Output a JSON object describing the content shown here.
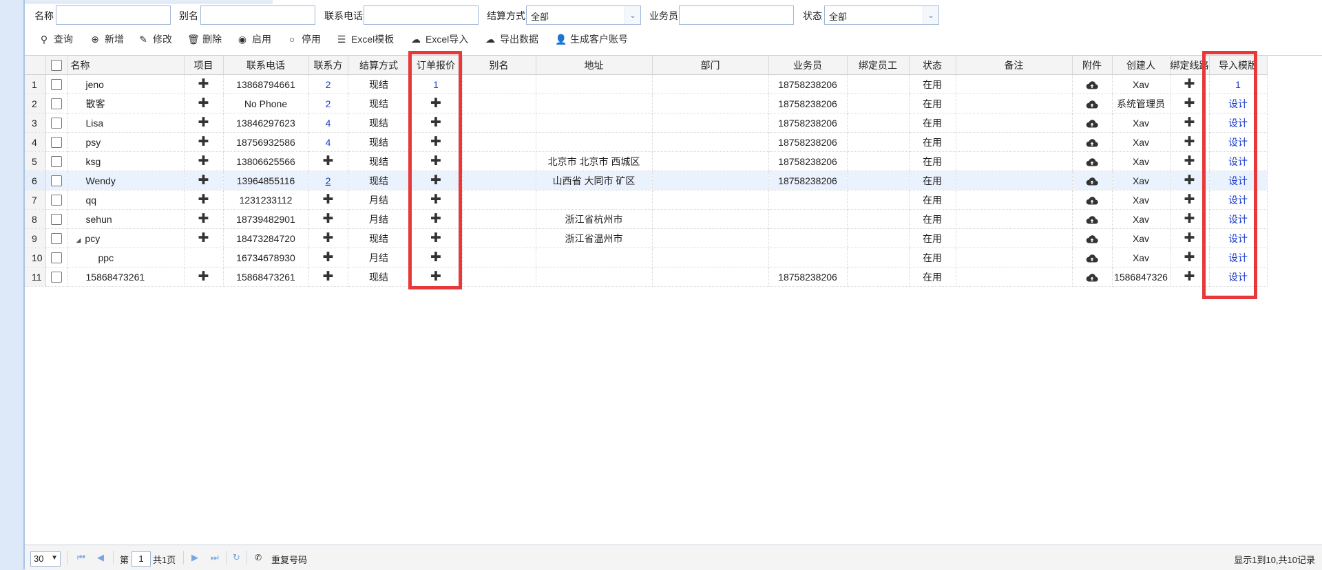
{
  "filters": {
    "name_label": "名称",
    "alias_label": "别名",
    "phone_label": "联系电话",
    "settlement_label": "结算方式",
    "settlement_value": "全部",
    "salesman_label": "业务员",
    "status_label": "状态",
    "status_value": "全部"
  },
  "toolbar": {
    "query": "查询",
    "add": "新增",
    "edit": "修改",
    "delete": "删除",
    "enable": "启用",
    "disable": "停用",
    "excel_template": "Excel模板",
    "excel_import": "Excel导入",
    "export": "导出数据",
    "gen_account": "生成客户账号"
  },
  "columns": [
    "名称",
    "项目",
    "联系电话",
    "联系方",
    "结算方式",
    "订单报价",
    "别名",
    "地址",
    "部门",
    "业务员",
    "绑定员工",
    "状态",
    "备注",
    "附件",
    "创建人",
    "绑定线路",
    "导入模版"
  ],
  "rows": [
    {
      "n": "1",
      "name": "jeno",
      "phone": "13868794661",
      "contacts": "2",
      "settle": "现结",
      "quote": "1",
      "addr": "",
      "salesman": "18758238206",
      "status": "在用",
      "creator": "Xav",
      "tpl": "1"
    },
    {
      "n": "2",
      "name": "散客",
      "phone": "No Phone",
      "contacts": "2",
      "settle": "现结",
      "quote": "",
      "addr": "",
      "salesman": "18758238206",
      "status": "在用",
      "creator": "系统管理员",
      "tpl": "设计"
    },
    {
      "n": "3",
      "name": "Lisa",
      "phone": "13846297623",
      "contacts": "4",
      "settle": "现结",
      "quote": "",
      "addr": "",
      "salesman": "18758238206",
      "status": "在用",
      "creator": "Xav",
      "tpl": "设计"
    },
    {
      "n": "4",
      "name": "psy",
      "phone": "18756932586",
      "contacts": "4",
      "settle": "现结",
      "quote": "",
      "addr": "",
      "salesman": "18758238206",
      "status": "在用",
      "creator": "Xav",
      "tpl": "设计"
    },
    {
      "n": "5",
      "name": "ksg",
      "phone": "13806625566",
      "contacts": "",
      "settle": "现结",
      "quote": "",
      "addr": "北京市 北京市 西城区",
      "salesman": "18758238206",
      "status": "在用",
      "creator": "Xav",
      "tpl": "设计"
    },
    {
      "n": "6",
      "name": "Wendy",
      "phone": "13964855116",
      "contacts": "2",
      "settle": "现结",
      "quote": "",
      "addr": "山西省 大同市 矿区",
      "salesman": "18758238206",
      "status": "在用",
      "creator": "Xav",
      "tpl": "设计"
    },
    {
      "n": "7",
      "name": "qq",
      "phone": "1231233112",
      "contacts": "",
      "settle": "月结",
      "quote": "",
      "addr": "",
      "salesman": "",
      "status": "在用",
      "creator": "Xav",
      "tpl": "设计"
    },
    {
      "n": "8",
      "name": "sehun",
      "phone": "18739482901",
      "contacts": "",
      "settle": "月结",
      "quote": "",
      "addr": "浙江省杭州市",
      "salesman": "",
      "status": "在用",
      "creator": "Xav",
      "tpl": "设计"
    },
    {
      "n": "9",
      "name": "pcy",
      "phone": "18473284720",
      "contacts": "",
      "settle": "现结",
      "quote": "",
      "addr": "浙江省温州市",
      "salesman": "",
      "status": "在用",
      "creator": "Xav",
      "tpl": "设计"
    },
    {
      "n": "10",
      "name": "ppc",
      "phone": "16734678930",
      "contacts": "",
      "settle": "月结",
      "quote": "",
      "addr": "",
      "salesman": "",
      "status": "在用",
      "creator": "Xav",
      "tpl": "设计"
    },
    {
      "n": "11",
      "name": "15868473261",
      "phone": "15868473261",
      "contacts": "",
      "settle": "现结",
      "quote": "",
      "addr": "",
      "salesman": "18758238206",
      "status": "在用",
      "creator": "1586847326",
      "tpl": "设计"
    }
  ],
  "pager": {
    "page_size": "30",
    "page_prefix": "第",
    "page_value": "1",
    "page_total": "共1页",
    "dup_label": "重复号码",
    "summary": "显示1到10,共10记录"
  },
  "icons": {
    "plus": "plus-icon",
    "cloud": "cloud-upload-icon"
  },
  "colors": {
    "highlight": "#e8393a",
    "link": "#1a3ccc",
    "selected_row": "#eaf2fd"
  }
}
